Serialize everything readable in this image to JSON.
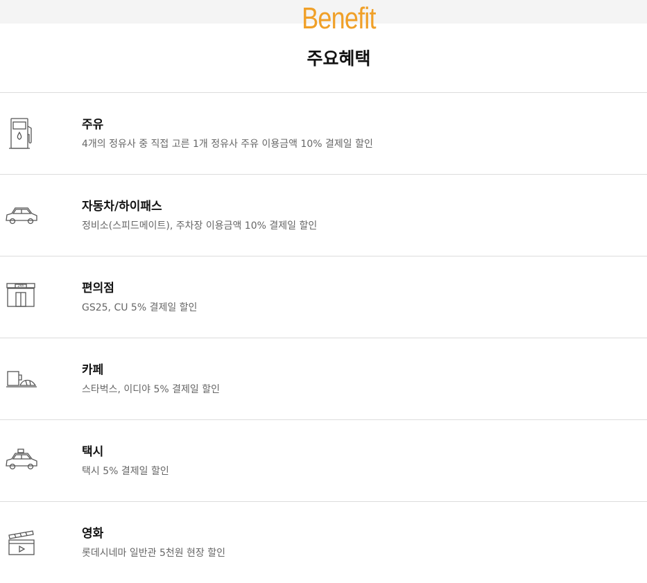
{
  "header": {
    "eyebrow": "Benefit",
    "title": "주요혜택"
  },
  "benefits": [
    {
      "icon": "fuel-pump-icon",
      "title": "주유",
      "description": "4개의 정유사 중 직접 고른 1개 정유사 주유 이용금액 10% 결제일 할인"
    },
    {
      "icon": "car-icon",
      "title": "자동차/하이패스",
      "description": "정비소(스피드메이트), 주차장 이용금액 10% 결제일 할인"
    },
    {
      "icon": "convenience-store-icon",
      "title": "편의점",
      "description": "GS25, CU 5% 결제일 할인",
      "icon_text": "24h"
    },
    {
      "icon": "cafe-icon",
      "title": "카페",
      "description": "스타벅스, 이디야 5% 결제일 할인"
    },
    {
      "icon": "taxi-icon",
      "title": "택시",
      "description": "택시 5% 결제일 할인"
    },
    {
      "icon": "movie-clapper-icon",
      "title": "영화",
      "description": "롯데시네마 일반관 5천원 현장 할인"
    }
  ],
  "colors": {
    "accent": "#f0a028",
    "divider": "#dcdcdc",
    "icon_stroke": "#555555"
  }
}
